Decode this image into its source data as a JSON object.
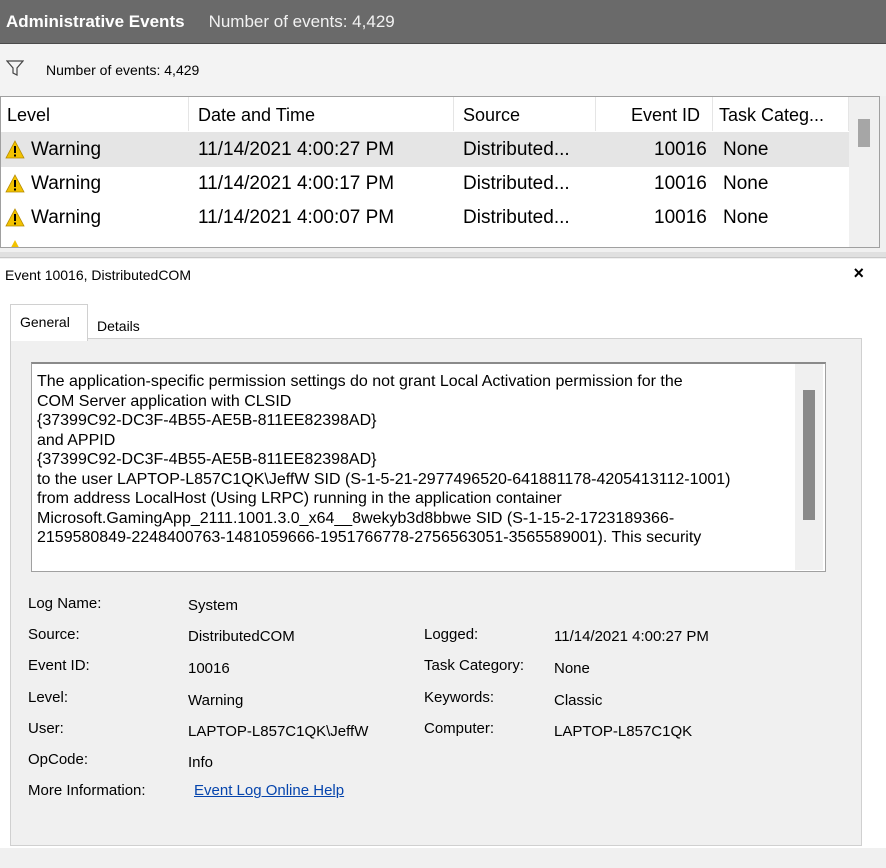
{
  "header": {
    "title": "Administrative Events",
    "count_text": "Number of events: 4,429"
  },
  "filter": {
    "icon": "filter-icon",
    "text": "Number of events: 4,429"
  },
  "list": {
    "columns": [
      "Level",
      "Date and Time",
      "Source",
      "Event ID",
      "Task Categ..."
    ],
    "rows": [
      {
        "level": "Warning",
        "date": "11/14/2021 4:00:27 PM",
        "source": "Distributed...",
        "event_id": "10016",
        "task": "None",
        "selected": true
      },
      {
        "level": "Warning",
        "date": "11/14/2021 4:00:17 PM",
        "source": "Distributed...",
        "event_id": "10016",
        "task": "None",
        "selected": false
      },
      {
        "level": "Warning",
        "date": "11/14/2021 4:00:07 PM",
        "source": "Distributed...",
        "event_id": "10016",
        "task": "None",
        "selected": false
      }
    ]
  },
  "detail": {
    "header": "Event 10016, DistributedCOM",
    "close": "×",
    "tabs": [
      "General",
      "Details"
    ],
    "message_lines": [
      "The application-specific permission settings do not grant Local Activation permission for the",
      "COM Server application with CLSID",
      "{37399C92-DC3F-4B55-AE5B-811EE82398AD}",
      " and APPID",
      "{37399C92-DC3F-4B55-AE5B-811EE82398AD}",
      " to the user LAPTOP-L857C1QK\\JeffW SID (S-1-5-21-2977496520-641881178-4205413112-1001)",
      "from address LocalHost (Using LRPC) running in the application container",
      "Microsoft.GamingApp_2111.1001.3.0_x64__8wekyb3d8bbwe SID (S-1-15-2-1723189366-",
      "2159580849-2248400763-1481059666-1951766778-2756563051-3565589001). This security"
    ],
    "properties": {
      "log_name_label": "Log Name:",
      "log_name": "System",
      "source_label": "Source:",
      "source": "DistributedCOM",
      "logged_label": "Logged:",
      "logged": "11/14/2021 4:00:27 PM",
      "event_id_label": "Event ID:",
      "event_id": "10016",
      "task_category_label": "Task Category:",
      "task_category": "None",
      "level_label": "Level:",
      "level": "Warning",
      "keywords_label": "Keywords:",
      "keywords": "Classic",
      "user_label": "User:",
      "user": "LAPTOP-L857C1QK\\JeffW",
      "computer_label": "Computer:",
      "computer": "LAPTOP-L857C1QK",
      "opcode_label": "OpCode:",
      "opcode": "Info",
      "more_info_label": "More Information:",
      "more_info_link": "Event Log Online Help"
    }
  },
  "colors": {
    "header_bg": "#6a6a6a",
    "selected_row": "#e5e5e5",
    "link": "#0645ad",
    "warning": "#f2c200"
  }
}
